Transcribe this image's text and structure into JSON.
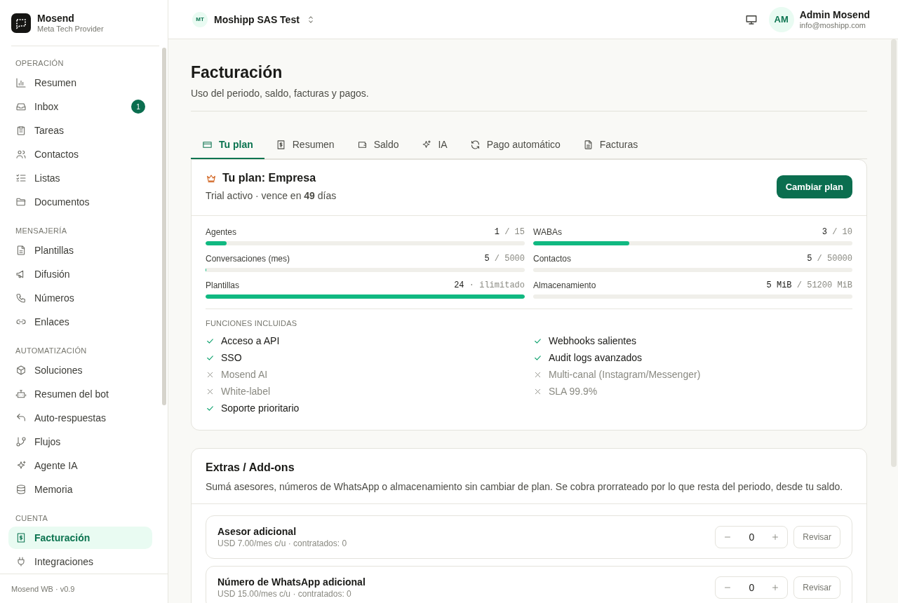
{
  "brand": {
    "name": "Mosend",
    "tagline": "Meta Tech Provider"
  },
  "sidebar": {
    "sections": [
      {
        "label": "OPERACIÓN",
        "items": [
          {
            "label": "Resumen",
            "selected": false
          },
          {
            "label": "Inbox",
            "selected": false,
            "badge": "1"
          },
          {
            "label": "Tareas",
            "selected": false
          },
          {
            "label": "Contactos",
            "selected": false
          },
          {
            "label": "Listas",
            "selected": false
          },
          {
            "label": "Documentos",
            "selected": false
          }
        ]
      },
      {
        "label": "MENSAJERÍA",
        "items": [
          {
            "label": "Plantillas",
            "selected": false
          },
          {
            "label": "Difusión",
            "selected": false
          },
          {
            "label": "Números",
            "selected": false
          },
          {
            "label": "Enlaces",
            "selected": false
          }
        ]
      },
      {
        "label": "AUTOMATIZACIÓN",
        "items": [
          {
            "label": "Soluciones",
            "selected": false
          },
          {
            "label": "Resumen del bot",
            "selected": false
          },
          {
            "label": "Auto-respuestas",
            "selected": false
          },
          {
            "label": "Flujos",
            "selected": false
          },
          {
            "label": "Agente IA",
            "selected": false
          },
          {
            "label": "Memoria",
            "selected": false
          }
        ]
      },
      {
        "label": "CUENTA",
        "items": [
          {
            "label": "Facturación",
            "selected": true
          },
          {
            "label": "Integraciones",
            "selected": false
          }
        ]
      }
    ],
    "footer": "Mosend WB · v0.9"
  },
  "topbar": {
    "org_initials": "MT",
    "org_name": "Moshipp SAS Test",
    "user_initials": "AM",
    "user_name": "Admin Mosend",
    "user_email": "info@moshipp.com"
  },
  "page": {
    "title": "Facturación",
    "subtitle": "Uso del periodo, saldo, facturas y pagos."
  },
  "tabs": [
    {
      "label": "Tu plan",
      "selected": true
    },
    {
      "label": "Resumen",
      "selected": false
    },
    {
      "label": "Saldo",
      "selected": false
    },
    {
      "label": "IA",
      "selected": false
    },
    {
      "label": "Pago automático",
      "selected": false
    },
    {
      "label": "Facturas",
      "selected": false
    }
  ],
  "plan": {
    "title": "Tu plan: Empresa",
    "status": "Trial activo · vence en **49** días",
    "button": "Cambiar plan",
    "usage": [
      {
        "name": "Agentes",
        "used": "1",
        "separator": "/",
        "limit": "15",
        "level": 0.067
      },
      {
        "name": "WABAs",
        "used": "3",
        "separator": "/",
        "limit": "10",
        "level": 0.3
      },
      {
        "name": "Conversaciones (mes)",
        "used": "5",
        "separator": "/",
        "limit": "5000",
        "level": 0.001
      },
      {
        "name": "Contactos",
        "used": "5",
        "separator": "/",
        "limit": "50000",
        "level": 0.0001
      },
      {
        "name": "Plantillas",
        "used": "24",
        "separator": "·",
        "limit": "ilimitado",
        "level": 1
      },
      {
        "name": "Almacenamiento",
        "used": "5 MiB",
        "separator": "/",
        "limit": "51200 MiB",
        "level": 0.0001
      }
    ],
    "features_heading": "FUNCIONES INCLUIDAS",
    "features": [
      {
        "label": "Acceso a API",
        "included": true
      },
      {
        "label": "Webhooks salientes",
        "included": true
      },
      {
        "label": "SSO",
        "included": true
      },
      {
        "label": "Audit logs avanzados",
        "included": true
      },
      {
        "label": "Mosend AI",
        "included": false
      },
      {
        "label": "Multi-canal (Instagram/Messenger)",
        "included": false
      },
      {
        "label": "White-label",
        "included": false
      },
      {
        "label": "SLA 99.9%",
        "included": false
      },
      {
        "label": "Soporte prioritario",
        "included": true
      }
    ]
  },
  "addons": {
    "title": "Extras / Add-ons",
    "description": "Sumá asesores, números de WhatsApp o almacenamiento sin cambiar de plan. Se cobra prorrateado por lo que resta del periodo, desde tu saldo.",
    "items": [
      {
        "name": "Asesor adicional",
        "detail": "USD 7.00/mes c/u · contratados: 0",
        "quantity": "0",
        "button": "Revisar"
      },
      {
        "name": "Número de WhatsApp adicional",
        "detail": "USD 15.00/mes c/u · contratados: 0",
        "quantity": "0",
        "button": "Revisar"
      }
    ]
  }
}
